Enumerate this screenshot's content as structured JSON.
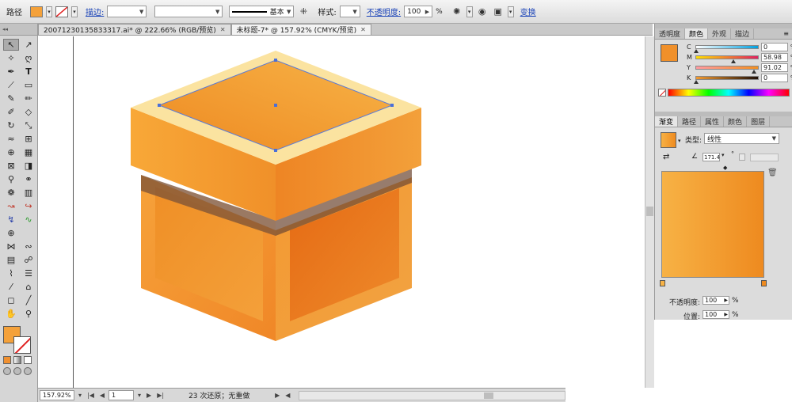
{
  "control_bar": {
    "object_type": "路径",
    "fill_color": "#f4a13a",
    "stroke_label": "描边:",
    "stroke_width": "",
    "brush_value": "",
    "stroke_profile": "基本",
    "style_label": "样式:",
    "opacity_label": "不透明度:",
    "opacity_value": "100",
    "opacity_unit": "%",
    "transform_label": "变换"
  },
  "tabs": [
    {
      "label": "20071230135833317.ai* @ 222.66% (RGB/预览)",
      "active": false
    },
    {
      "label": "未标题-7* @ 157.92% (CMYK/预览)",
      "active": true
    }
  ],
  "toolbox": {
    "fill_color": "#f4a13a"
  },
  "status_bar": {
    "zoom": "157.92%",
    "page": "1",
    "status_text": "23 次还原；无重做"
  },
  "color_panel": {
    "tabs": [
      "透明度",
      "颜色",
      "外观",
      "描边"
    ],
    "active_tab": "颜色",
    "fill_color": "#f0902a",
    "channels": [
      {
        "label": "C",
        "value": "0",
        "pct": "%",
        "level": 0.0
      },
      {
        "label": "M",
        "value": "58.98",
        "pct": "%",
        "level": 0.5898
      },
      {
        "label": "Y",
        "value": "91.02",
        "pct": "%",
        "level": 0.9102
      },
      {
        "label": "K",
        "value": "0",
        "pct": "%",
        "level": 0.0
      }
    ]
  },
  "gradient_panel": {
    "tabs": [
      "渐变",
      "路径",
      "属性",
      "颜色",
      "图层"
    ],
    "active_tab": "渐变",
    "type_label": "类型:",
    "type_value": "线性",
    "angle_value": "171.4",
    "angle_unit": "°",
    "start_color": "#f7b245",
    "end_color": "#ee8a1f",
    "opacity_label": "不透明度:",
    "opacity_value": "100",
    "opacity_unit": "%",
    "position_label": "位置:",
    "position_value": "100",
    "position_unit": "%"
  },
  "canvas": {
    "box_colors": {
      "lid_top_face": "#f29a2f",
      "lid_rim": "#fde7a6",
      "lid_front": "#f7a63a",
      "lid_right": "#ec8a23",
      "band": "#8a5a3a",
      "body_left": "#f49330",
      "body_right": "#e9741a"
    }
  }
}
